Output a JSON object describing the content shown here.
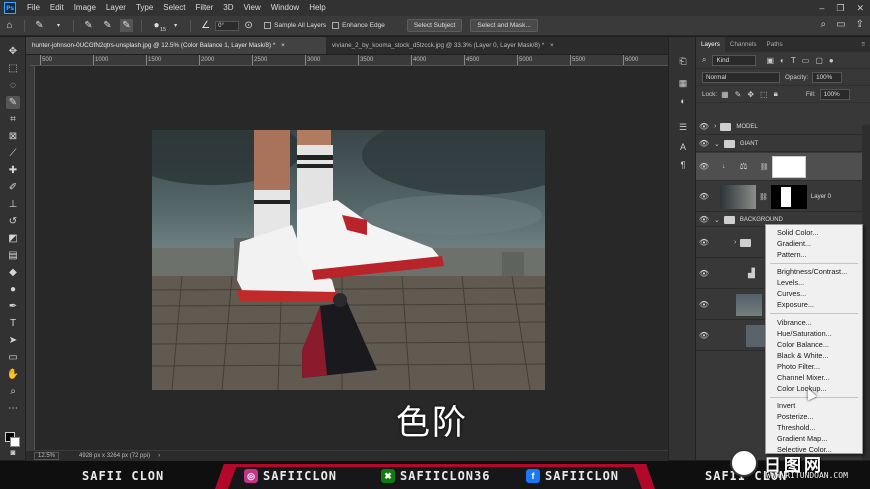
{
  "app": {
    "logo_text": "Ps",
    "menu": [
      "File",
      "Edit",
      "Image",
      "Layer",
      "Type",
      "Select",
      "Filter",
      "3D",
      "View",
      "Window",
      "Help"
    ]
  },
  "options_bar": {
    "brush_size": "15",
    "angle_value": "0°",
    "sample_all_layers": "Sample All Layers",
    "enhance_edge": "Enhance Edge",
    "select_subject": "Select Subject",
    "select_and_mask": "Select and Mask..."
  },
  "document_tabs": [
    {
      "title": "hunter-johnson-0UCGfN2qtrs-unsplash.jpg @ 12.5% (Color Balance 1, Layer Mask/8) *",
      "close": "×",
      "active": true
    },
    {
      "title": "viviane_2_by_kooma_stock_d5lzcck.jpg @ 33.3% (Layer 0, Layer Mask/8) *",
      "close": "×",
      "active": false
    }
  ],
  "ruler_ticks": [
    "500",
    "1000",
    "1500",
    "2000",
    "2500",
    "3000",
    "3500",
    "4000",
    "4500",
    "5000",
    "5500",
    "6000"
  ],
  "canvas_overlay_text": "色阶",
  "status": {
    "zoom": "12.5%",
    "doc_info": "4928 px x 3264 px (72 ppi)"
  },
  "layers_panel": {
    "tabs": [
      "Layers",
      "Channels",
      "Paths"
    ],
    "filter_kind": "Kind",
    "blend_mode": "Normal",
    "opacity_label": "Opacity:",
    "opacity_value": "100%",
    "lock_label": "Lock:",
    "fill_label": "Fill:",
    "fill_value": "100%",
    "layers": [
      {
        "name": "MODEL",
        "type": "group"
      },
      {
        "name": "GIANT",
        "type": "group"
      },
      {
        "name": "",
        "type": "adjustment"
      },
      {
        "name": "Layer 0",
        "type": "layer"
      },
      {
        "name": "BACKGROUND",
        "type": "group"
      }
    ]
  },
  "adjustment_menu": {
    "groups": [
      [
        "Solid Color...",
        "Gradient...",
        "Pattern..."
      ],
      [
        "Brightness/Contrast...",
        "Levels...",
        "Curves...",
        "Exposure..."
      ],
      [
        "Vibrance...",
        "Hue/Saturation...",
        "Color Balance...",
        "Black & White...",
        "Photo Filter...",
        "Channel Mixer...",
        "Color Lookup..."
      ],
      [
        "Invert",
        "Posterize...",
        "Threshold...",
        "Gradient Map...",
        "Selective Color..."
      ]
    ]
  },
  "footer": {
    "channel": "SAFII CLON",
    "instagram": "SAFIICLON",
    "xbox": "SAFIICLON36",
    "facebook": "SAFIICLON",
    "right_partial": "SAFII CLON"
  },
  "watermark": {
    "text": "日图网",
    "url": "WWW.RITUNDOAN.COM"
  },
  "colors": {
    "accent": "#31a8ff",
    "footer_red": "#b2082a",
    "instagram": "#c13584",
    "xbox": "#107c10",
    "facebook": "#1877f2"
  }
}
